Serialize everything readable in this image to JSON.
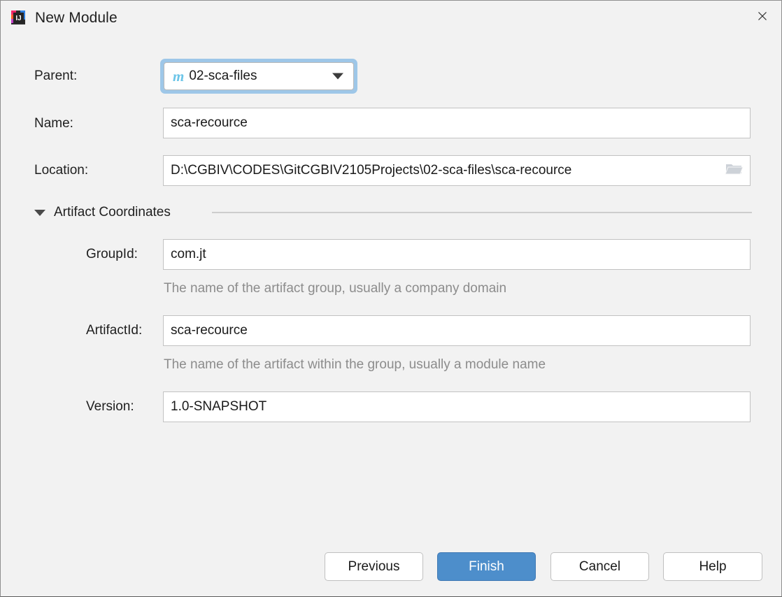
{
  "window": {
    "title": "New Module",
    "app_icon": "intellij-idea-icon",
    "close_label": "✕",
    "bg_color": "#f2f2f2"
  },
  "form": {
    "parent": {
      "label": "Parent:",
      "value": "02-sca-files",
      "icon": "maven-icon",
      "icon_glyph": "m",
      "focused": true,
      "focus_ring_color": "#9ec7e8"
    },
    "name": {
      "label": "Name:",
      "value": "sca-recource",
      "placeholder": ""
    },
    "location": {
      "label": "Location:",
      "value": "D:\\CGBIV\\CODES\\GitCGBIV2105Projects\\02-sca-files\\sca-recource",
      "placeholder": "",
      "browse_icon": "folder-icon"
    }
  },
  "artifact_section": {
    "title": "Artifact Coordinates",
    "expanded": true,
    "fields": {
      "group_id": {
        "label": "GroupId:",
        "value": "com.jt",
        "hint": "The name of the artifact group, usually a company domain"
      },
      "artifact_id": {
        "label": "ArtifactId:",
        "value": "sca-recource",
        "hint": "The name of the artifact within the group, usually a module name"
      },
      "version": {
        "label": "Version:",
        "value": "1.0-SNAPSHOT",
        "hint": ""
      }
    }
  },
  "buttons": {
    "previous": "Previous",
    "finish": "Finish",
    "cancel": "Cancel",
    "help": "Help",
    "primary_color": "#4d8ecb"
  }
}
